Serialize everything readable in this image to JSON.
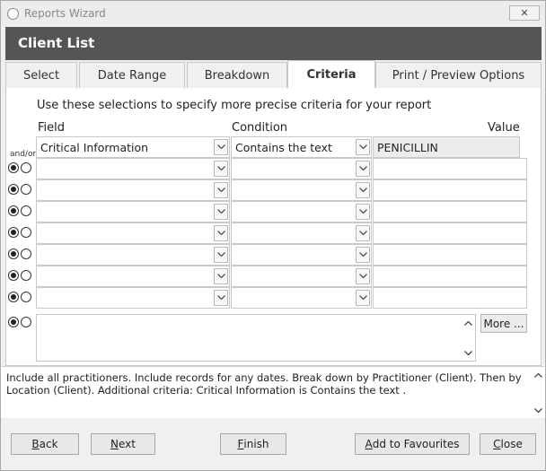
{
  "window": {
    "title": "Reports Wizard",
    "close_label": "✕"
  },
  "header": {
    "title": "Client List"
  },
  "tabs": [
    {
      "label": "Select"
    },
    {
      "label": "Date Range"
    },
    {
      "label": "Breakdown"
    },
    {
      "label": "Criteria"
    },
    {
      "label": "Print / Preview Options"
    }
  ],
  "criteria": {
    "instructions": "Use these selections to specify more precise criteria for your report",
    "col_field": "Field",
    "col_condition": "Condition",
    "col_value": "Value",
    "andor_label": "and/or",
    "rows": [
      {
        "field": "Critical Information",
        "condition": "Contains the text",
        "value": "PENICILLIN"
      },
      {
        "field": "",
        "condition": "",
        "value": ""
      },
      {
        "field": "",
        "condition": "",
        "value": ""
      },
      {
        "field": "",
        "condition": "",
        "value": ""
      },
      {
        "field": "",
        "condition": "",
        "value": ""
      },
      {
        "field": "",
        "condition": "",
        "value": ""
      },
      {
        "field": "",
        "condition": "",
        "value": ""
      },
      {
        "field": "",
        "condition": "",
        "value": ""
      }
    ],
    "more_label": "More ..."
  },
  "summary": {
    "text": "Include all practitioners. Include records for any dates. Break down by Practitioner (Client). Then by Location (Client). Additional criteria: Critical Information is Contains the text ."
  },
  "buttons": {
    "back_u": "B",
    "back_rest": "ack",
    "next_u": "N",
    "next_rest": "ext",
    "finish_u": "F",
    "finish_rest": "inish",
    "fav_pre": "",
    "fav_u": "A",
    "fav_rest": "dd to Favourites",
    "close_u": "C",
    "close_rest": "lose"
  }
}
